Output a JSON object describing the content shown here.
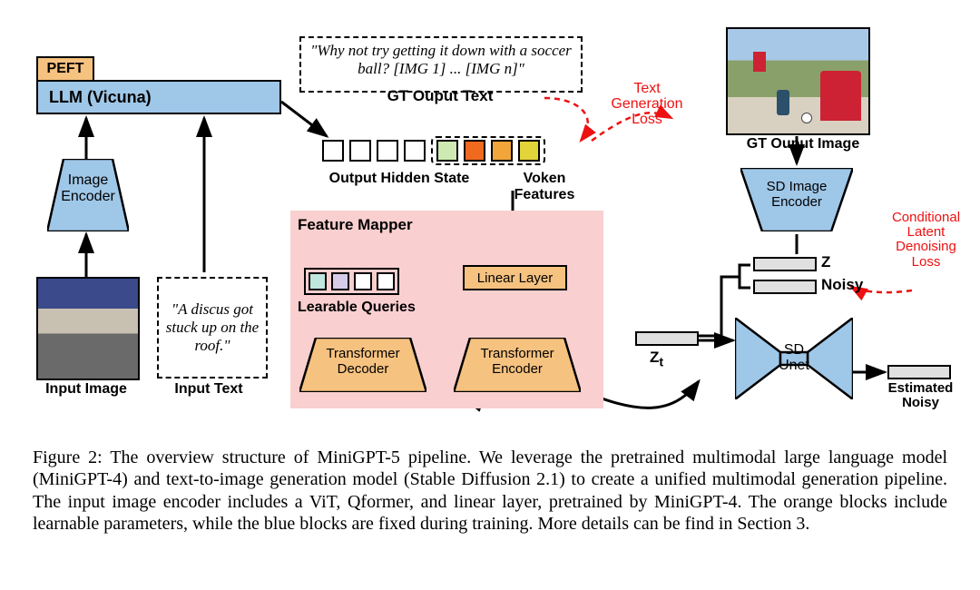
{
  "llm": {
    "peft": "PEFT",
    "name": "LLM (Vicuna)"
  },
  "image_encoder": "Image\nEncoder",
  "input_image_label": "Input Image",
  "input_text": "\"A discus got stuck up on the roof.\"",
  "input_text_label": "Input Text",
  "gt_text": "\"Why not try getting it down with a soccer ball? [IMG 1] ... [IMG n]\"",
  "gt_text_label": "GT Ouput Text",
  "output_hidden_state": "Output Hidden State",
  "voken_features": "Voken\nFeatures",
  "text_gen_loss": "Text\nGeneration\nLoss",
  "gt_output_image": "GT Ouput Image",
  "feature_mapper": {
    "title": "Feature Mapper",
    "learnable_queries": "Learable Queries",
    "linear_layer": "Linear Layer",
    "decoder": "Transformer\nDecoder",
    "encoder": "Transformer\nEncoder"
  },
  "sd_image_encoder": "SD Image\nEncoder",
  "z": "Z",
  "noisy": "Noisy",
  "zt": "Zt",
  "sd_unet": "SD\nUnet",
  "estimated_noisy": "Estimated\nNoisy",
  "cond_loss": "Conditional\nLatent\nDenoising\nLoss",
  "caption": "Figure 2: The overview structure of MiniGPT-5 pipeline. We leverage the pretrained multimodal large language model (MiniGPT-4) and text-to-image generation model (Stable Diffusion 2.1) to create a unified multimodal generation pipeline. The input image encoder includes a ViT, Qformer, and linear layer, pretrained by MiniGPT-4. The orange blocks include learnable parameters, while the blue blocks are fixed during training. More details can be find in Section 3."
}
